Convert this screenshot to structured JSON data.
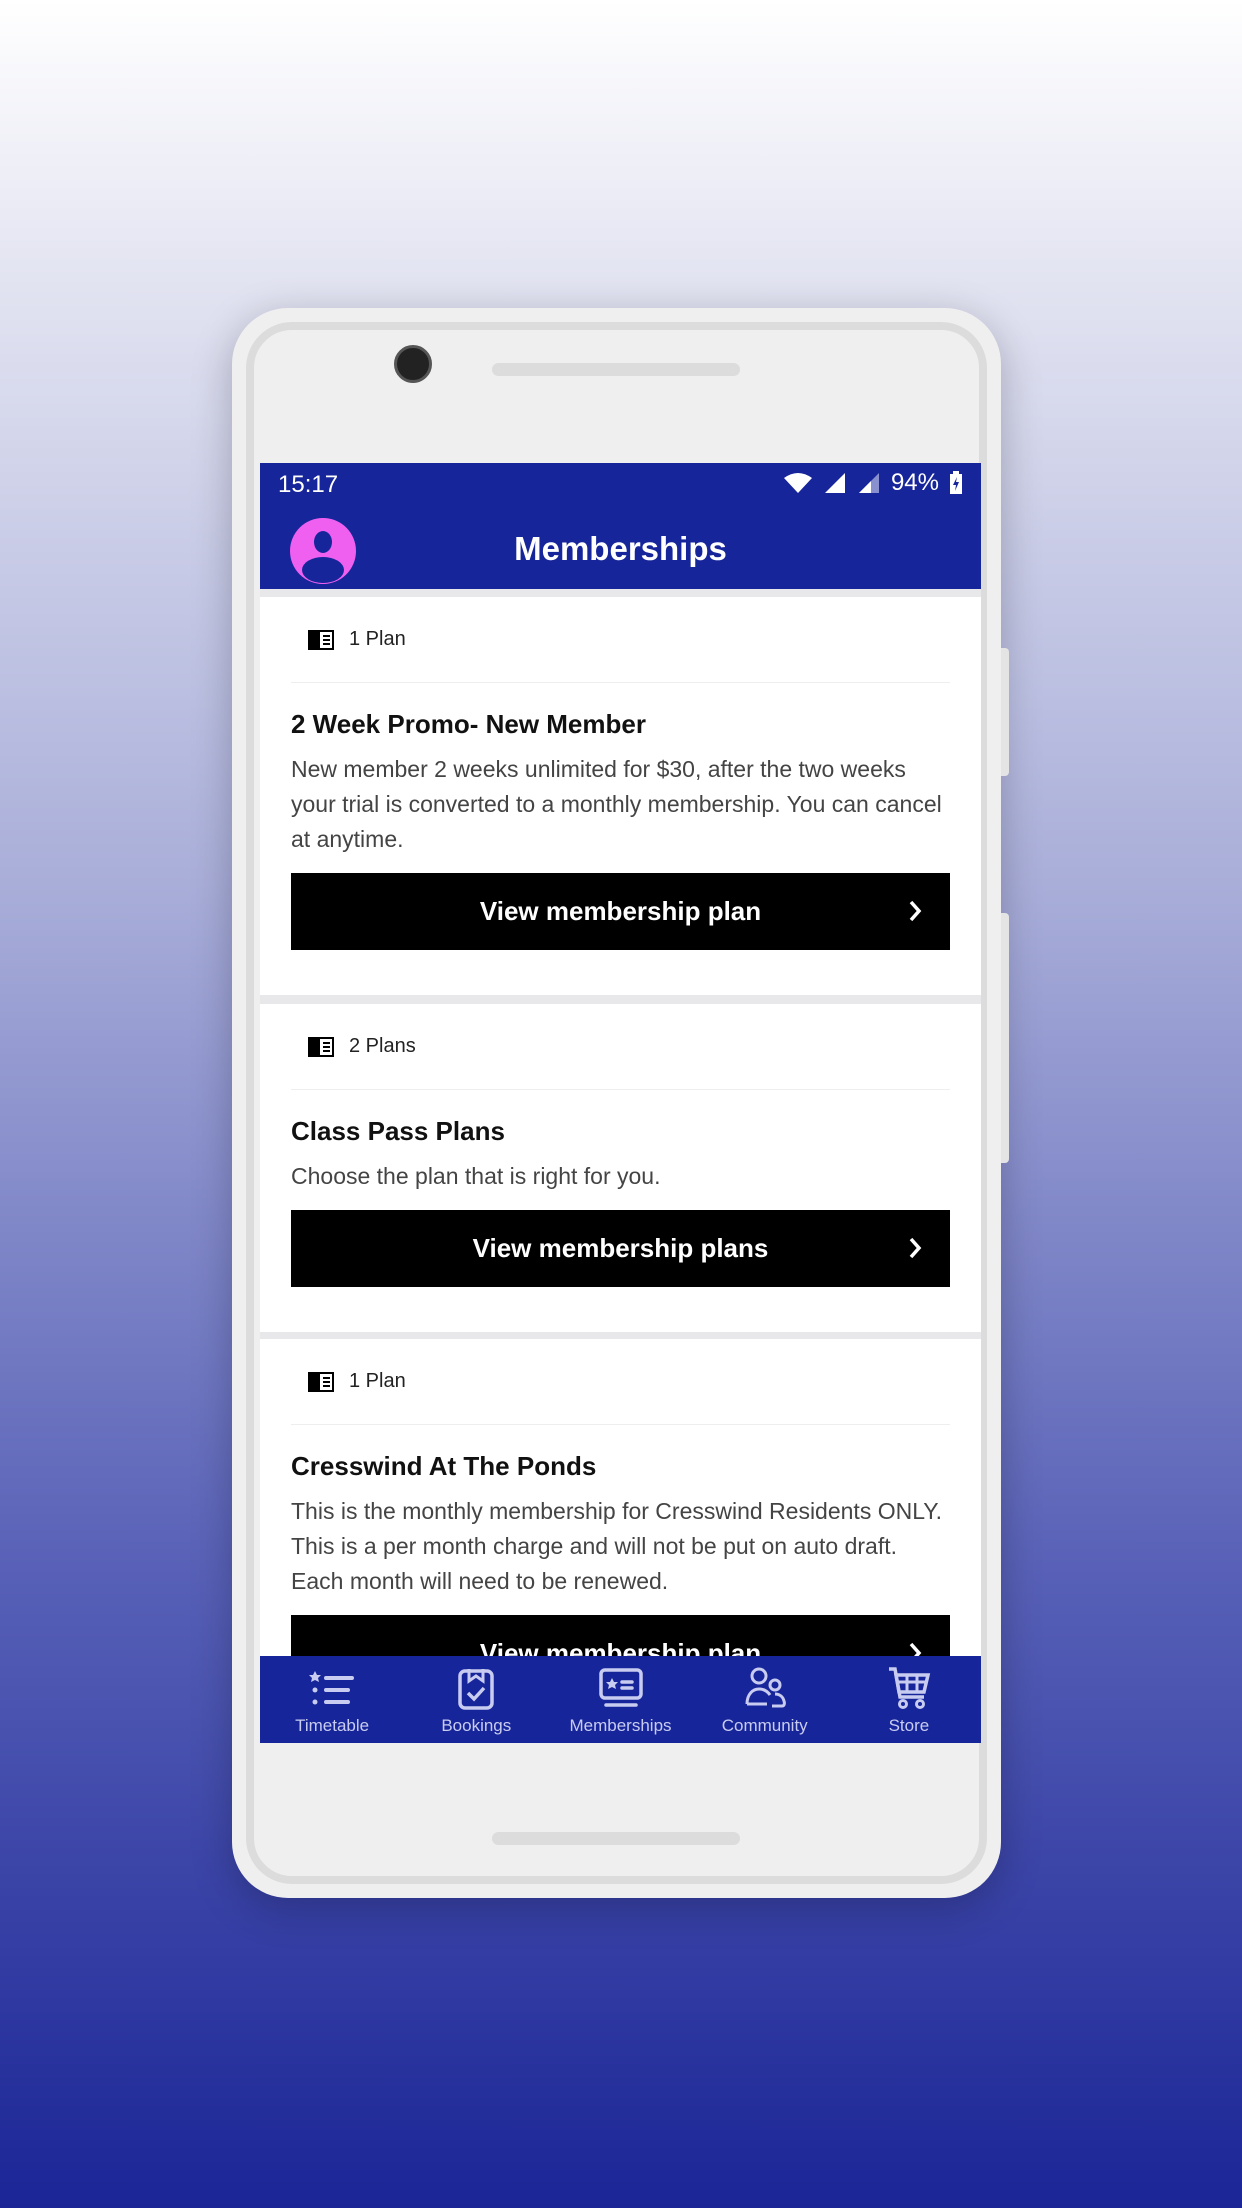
{
  "status_bar": {
    "time": "15:17",
    "battery": "94%"
  },
  "header": {
    "title": "Memberships"
  },
  "cards": [
    {
      "plan_count": "1 Plan",
      "title": "2 Week Promo- New Member",
      "description": "New member 2 weeks unlimited for $30, after the two weeks your trial is converted to a monthly membership. You can cancel at anytime.",
      "button": "View membership plan"
    },
    {
      "plan_count": "2 Plans",
      "title": "Class Pass Plans",
      "description": "Choose the plan that is right for you.",
      "button": "View membership plans"
    },
    {
      "plan_count": "1 Plan",
      "title": "Cresswind At The Ponds",
      "description": "This is the monthly membership for Cresswind Residents ONLY. This is a per month charge and will not be put on auto draft. Each month will need to be renewed.",
      "button": "View membership plan"
    }
  ],
  "bottom_nav": {
    "items": [
      {
        "label": "Timetable",
        "icon": "list-star-icon"
      },
      {
        "label": "Bookings",
        "icon": "clipboard-check-icon"
      },
      {
        "label": "Memberships",
        "icon": "membership-card-icon",
        "active": true
      },
      {
        "label": "Community",
        "icon": "people-icon"
      },
      {
        "label": "Store",
        "icon": "cart-icon"
      }
    ]
  },
  "colors": {
    "brand": "#17259a",
    "avatar": "#f060f0",
    "button": "#000000"
  }
}
